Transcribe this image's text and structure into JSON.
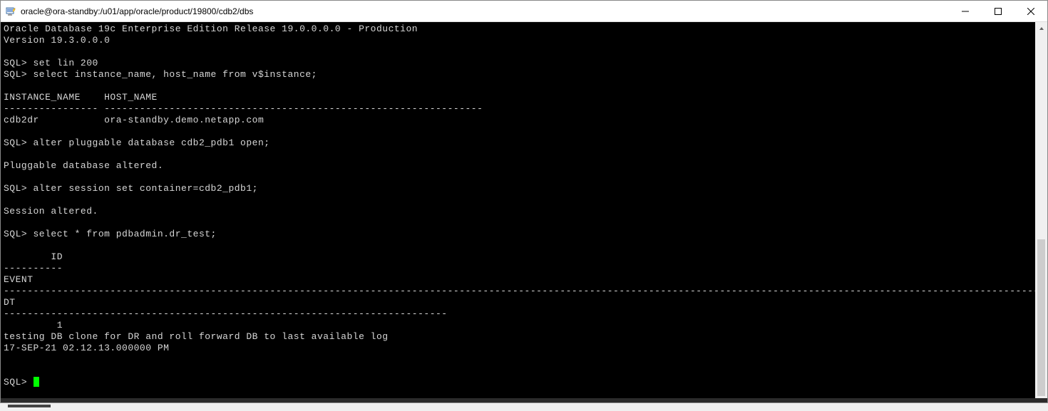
{
  "window": {
    "title": "oracle@ora-standby:/u01/app/oracle/product/19800/cdb2/dbs"
  },
  "terminal": {
    "lines": [
      "Oracle Database 19c Enterprise Edition Release 19.0.0.0.0 - Production",
      "Version 19.3.0.0.0",
      "",
      "SQL> set lin 200",
      "SQL> select instance_name, host_name from v$instance;",
      "",
      "INSTANCE_NAME    HOST_NAME",
      "---------------- ----------------------------------------------------------------",
      "cdb2dr           ora-standby.demo.netapp.com",
      "",
      "SQL> alter pluggable database cdb2_pdb1 open;",
      "",
      "Pluggable database altered.",
      "",
      "SQL> alter session set container=cdb2_pdb1;",
      "",
      "Session altered.",
      "",
      "SQL> select * from pdbadmin.dr_test;",
      "",
      "        ID",
      "----------",
      "EVENT",
      "--------------------------------------------------------------------------------------------------------------------------------------------------------------------------------------------------------",
      "DT",
      "---------------------------------------------------------------------------",
      "         1",
      "testing DB clone for DR and roll forward DB to last available log",
      "17-SEP-21 02.12.13.000000 PM",
      "",
      "",
      "SQL> "
    ]
  }
}
